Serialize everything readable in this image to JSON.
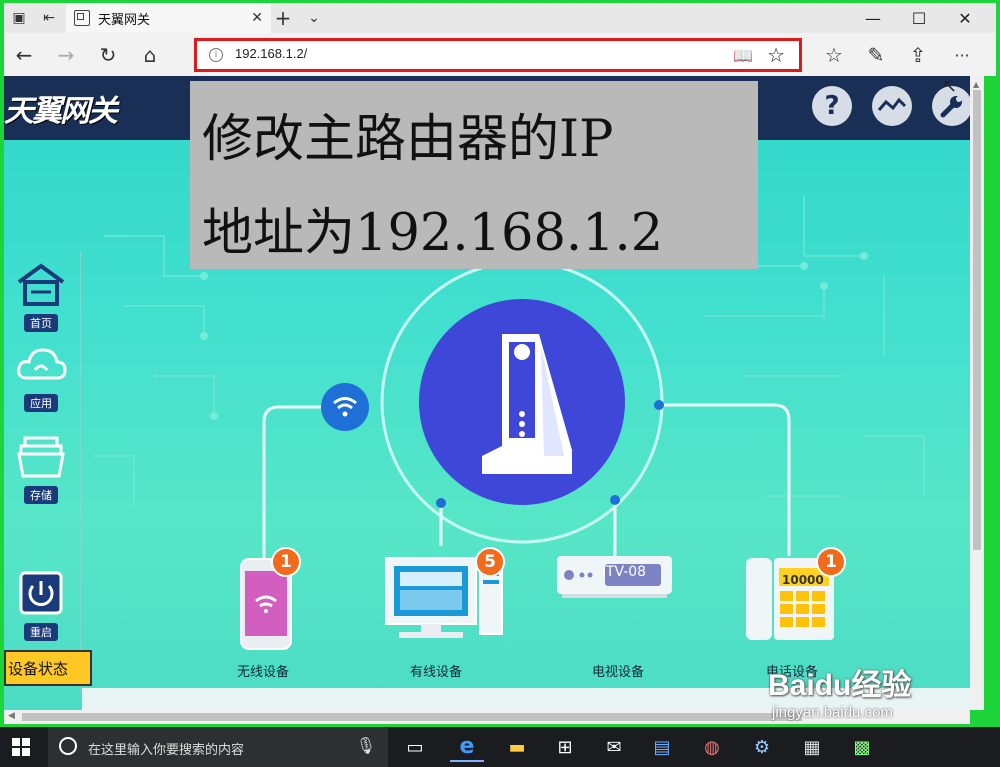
{
  "browser": {
    "tab_title": "天翼网关",
    "new_tab": "+",
    "tab_menu": "⌄",
    "tab_close": "✕",
    "window": {
      "minimize": "—",
      "maximize": "☐",
      "close": "✕"
    },
    "url": "192.168.1.2/",
    "nav": {
      "back": "←",
      "forward": "→",
      "refresh": "↻",
      "home": "⌂"
    },
    "toolbar": {
      "favorites": "☆",
      "notes": "✎",
      "share": "⇪",
      "more": "···"
    }
  },
  "page": {
    "brand": "天翼网关",
    "header_icons": [
      "help-icon",
      "network-icon",
      "settings-wrench-icon"
    ],
    "overlay_lines": [
      "修改主路由器的IP",
      "地址为192.168.1.2"
    ],
    "sidebar": [
      {
        "label": "首页",
        "icon": "home-icon"
      },
      {
        "label": "应用",
        "icon": "cloud-icon"
      },
      {
        "label": "存储",
        "icon": "storage-icon"
      },
      {
        "label": "重启",
        "icon": "power-icon"
      }
    ],
    "status_button": "设备状态",
    "devices": [
      {
        "label": "无线设备",
        "count": "1",
        "icon": "phone-icon"
      },
      {
        "label": "有线设备",
        "count": "5",
        "icon": "desktop-icon"
      },
      {
        "label": "电视设备",
        "count": "",
        "icon": "tv-box-icon",
        "box_text": "iTV-08"
      },
      {
        "label": "电话设备",
        "count": "1",
        "icon": "telephone-icon",
        "screen_text": "10000"
      }
    ],
    "colors": {
      "header": "#1a2f55",
      "hub": "#3e47d8",
      "badge": "#f26a1b",
      "status_btn": "#ffc825"
    }
  },
  "watermark": {
    "brand": "Baidu经验",
    "url": "jingyan.baidu.com"
  },
  "taskbar": {
    "search_placeholder": "在这里输入你要搜索的内容",
    "apps": [
      "task-view-icon",
      "edge-icon",
      "file-explorer-icon",
      "store-icon",
      "mail-icon",
      "network-app-icon",
      "paint-icon",
      "tools-icon",
      "notepad-icon",
      "control-panel-icon"
    ]
  }
}
